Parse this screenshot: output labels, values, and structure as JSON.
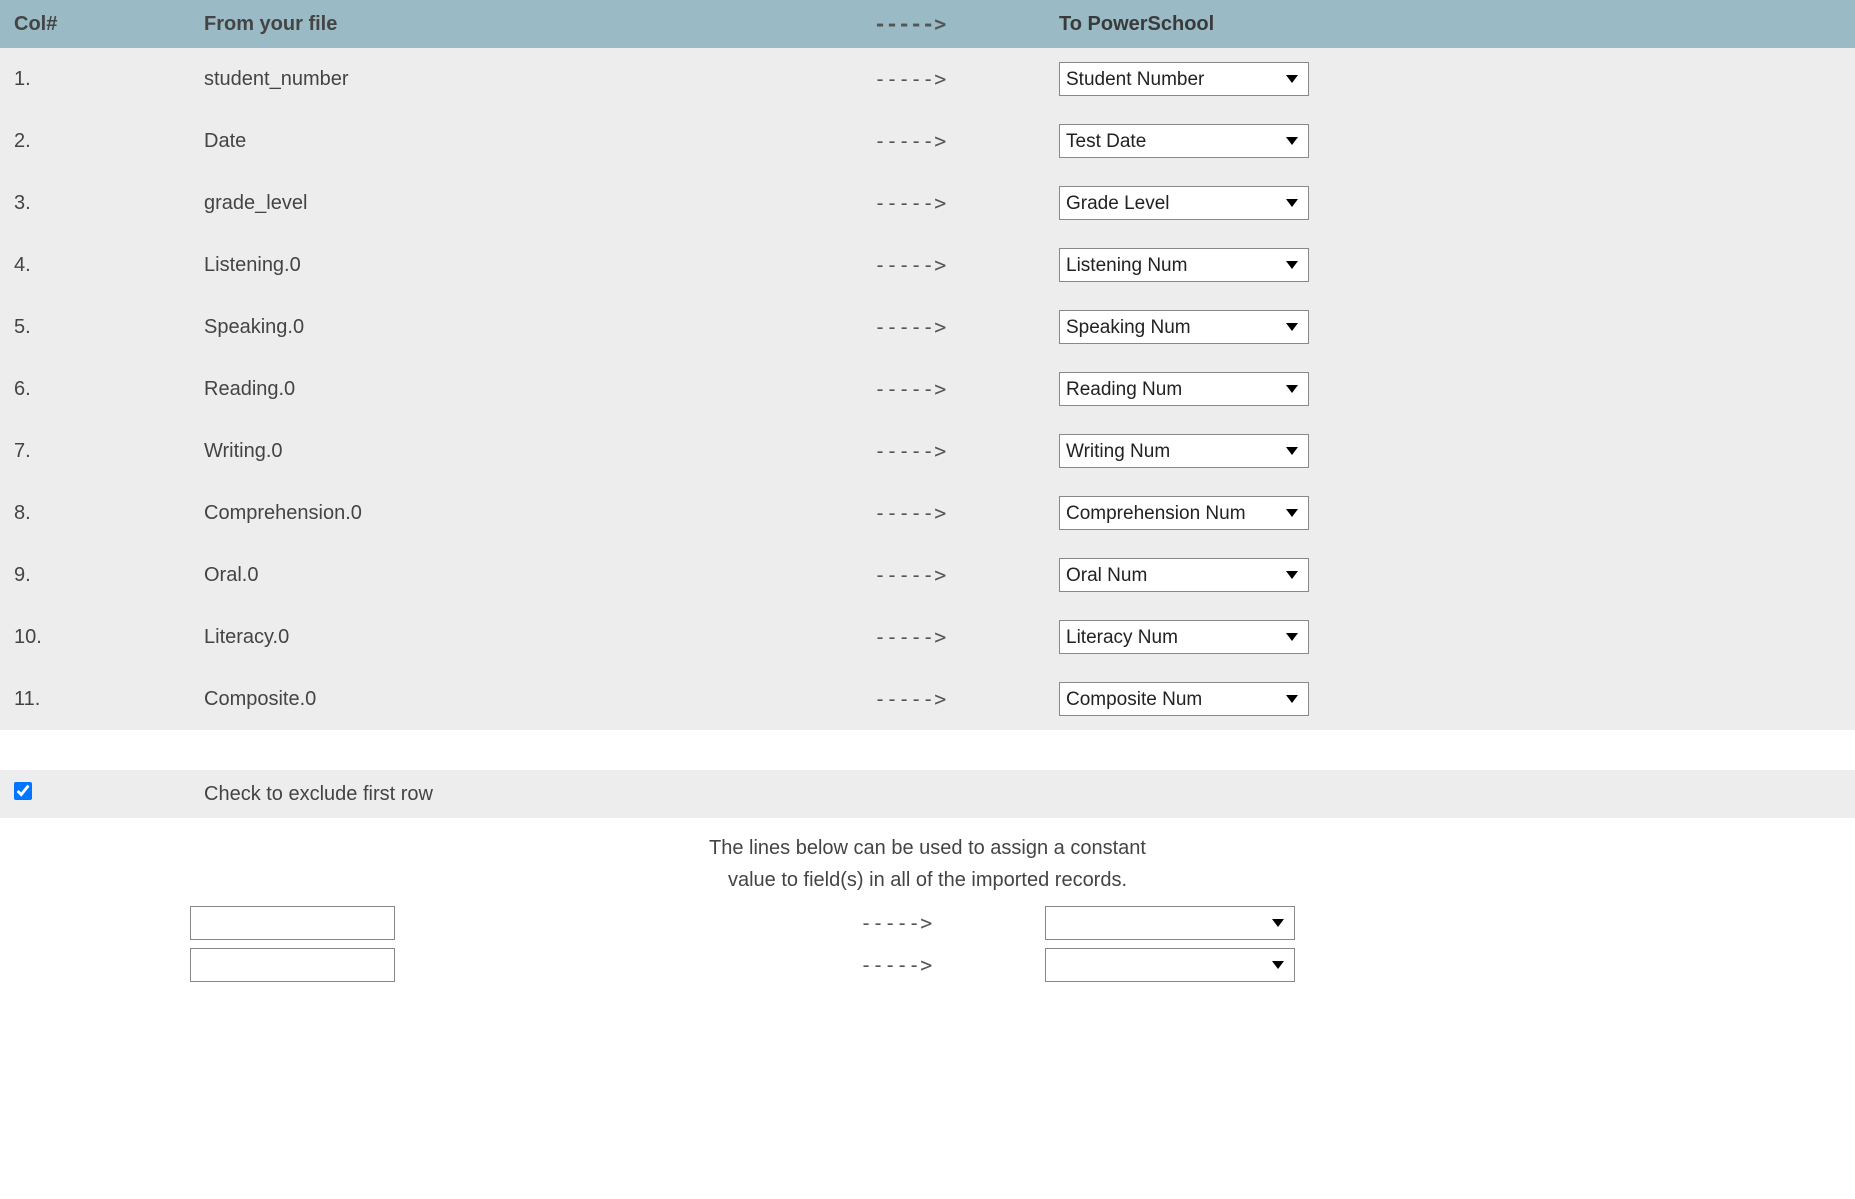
{
  "table": {
    "headers": {
      "col_num": "Col#",
      "from": "From your file",
      "arrow": "----->",
      "to": "To PowerSchool"
    },
    "rows": [
      {
        "num": "1.",
        "from": "student_number",
        "to": "Student Number"
      },
      {
        "num": "2.",
        "from": "Date",
        "to": "Test Date"
      },
      {
        "num": "3.",
        "from": "grade_level",
        "to": "Grade Level"
      },
      {
        "num": "4.",
        "from": "Listening.0",
        "to": "Listening Num"
      },
      {
        "num": "5.",
        "from": "Speaking.0",
        "to": "Speaking Num"
      },
      {
        "num": "6.",
        "from": "Reading.0",
        "to": "Reading Num"
      },
      {
        "num": "7.",
        "from": "Writing.0",
        "to": "Writing Num"
      },
      {
        "num": "8.",
        "from": "Comprehension.0",
        "to": "Comprehension Num"
      },
      {
        "num": "9.",
        "from": "Oral.0",
        "to": "Oral Num"
      },
      {
        "num": "10.",
        "from": "Literacy.0",
        "to": "Literacy Num"
      },
      {
        "num": "11.",
        "from": "Composite.0",
        "to": "Composite Num"
      }
    ],
    "arrow": "----->"
  },
  "exclude": {
    "label": "Check to exclude first row",
    "checked": true
  },
  "constants": {
    "note_line1": "The lines below can be used to assign a constant",
    "note_line2": "value to field(s) in all of the imported records.",
    "rows": [
      {
        "value": "",
        "to": ""
      },
      {
        "value": "",
        "to": ""
      }
    ],
    "arrow": "----->"
  }
}
